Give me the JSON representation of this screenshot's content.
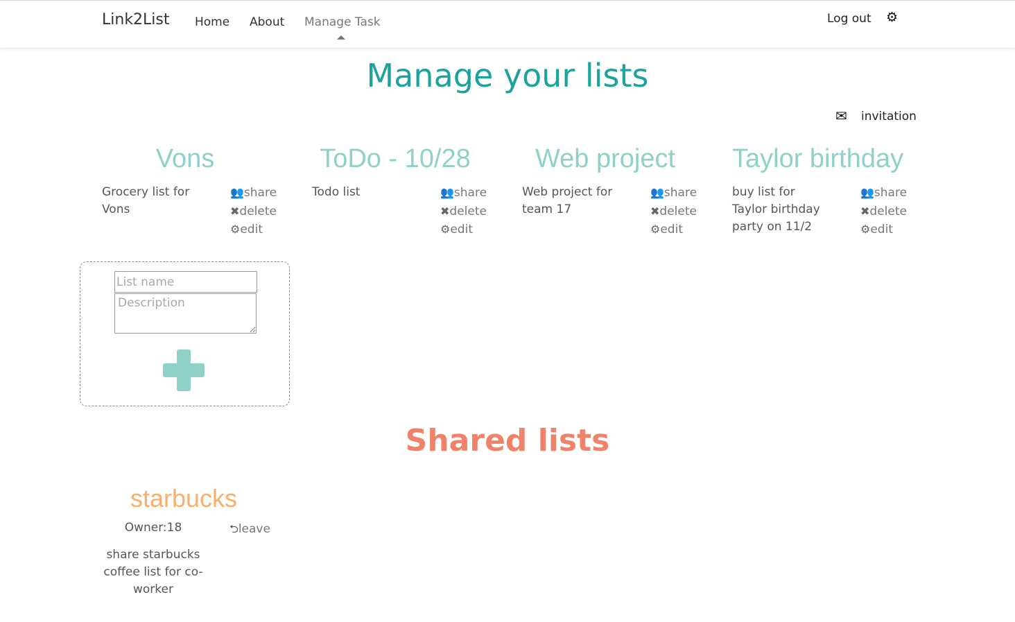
{
  "nav": {
    "brand": "Link2List",
    "links": [
      {
        "label": "Home"
      },
      {
        "label": "About"
      },
      {
        "label": "Manage Task",
        "active": true
      }
    ],
    "logout": "Log out",
    "settings_icon": "gear-icon"
  },
  "page": {
    "title": "Manage your lists",
    "invitation_label": "invitation",
    "invitation_icon": "envelope-icon"
  },
  "lists": [
    {
      "name": "Vons",
      "description": "Grocery list for Vons"
    },
    {
      "name": "ToDo - 10/28",
      "description": "Todo list"
    },
    {
      "name": "Web project",
      "description": "Web project for team 17"
    },
    {
      "name": "Taylor birthday",
      "description": "buy list for Taylor birthday party on 11/2"
    }
  ],
  "actions": {
    "share": "share",
    "delete": "delete",
    "edit": "edit"
  },
  "new_list_form": {
    "name_placeholder": "List name",
    "description_placeholder": "Description",
    "add_icon": "plus-icon"
  },
  "shared": {
    "title": "Shared lists",
    "items": [
      {
        "name": "starbucks",
        "owner": "Owner:18",
        "leave_label": "leave",
        "description": "share starbucks coffee list for co-worker"
      }
    ]
  },
  "colors": {
    "title": "#1ba39c",
    "list_title": "#8fd1c8",
    "shared_title": "#f1826a",
    "shared_name": "#f7b06b"
  }
}
